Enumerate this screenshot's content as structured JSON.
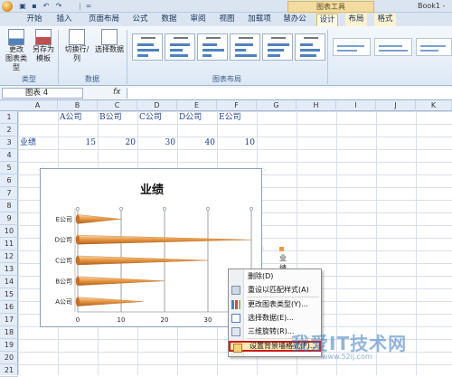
{
  "titlebar": {
    "chart_tools_label": "图表工具",
    "book_title": "Book1 -",
    "qat_separator": "|",
    "qat_arrow": "="
  },
  "tabs": [
    {
      "label": "开始"
    },
    {
      "label": "插入"
    },
    {
      "label": "页面布局"
    },
    {
      "label": "公式"
    },
    {
      "label": "数据"
    },
    {
      "label": "审阅"
    },
    {
      "label": "视图"
    },
    {
      "label": "加载项"
    },
    {
      "label": "慧办公"
    },
    {
      "label": "设计"
    },
    {
      "label": "布局"
    },
    {
      "label": "格式"
    }
  ],
  "ribbon": {
    "type_group": {
      "change_type": "更改\n图表类型",
      "save_template": "另存为\n模板",
      "label": "类型"
    },
    "data_group": {
      "switch_row_col": "切换行/列",
      "select_data": "选择数据",
      "label": "数据"
    },
    "layout_group": {
      "label": "图表布局"
    }
  },
  "formula_bar": {
    "name_box": "图表 4",
    "fx": "fx"
  },
  "grid": {
    "columns": [
      "A",
      "B",
      "C",
      "D",
      "E",
      "F",
      "G",
      "H",
      "I",
      "J",
      "K"
    ],
    "rows": [
      "1",
      "2",
      "3",
      "4",
      "5",
      "6",
      "7",
      "8",
      "9",
      "10",
      "11",
      "12",
      "13",
      "14",
      "15",
      "16",
      "17",
      "18",
      "19",
      "20",
      "21"
    ],
    "cells": {
      "b1": "A公司",
      "c1": "B公司",
      "d1": "C公司",
      "e1": "D公司",
      "f1": "E公司",
      "a2": "业绩",
      "b2": "15",
      "c2": "20",
      "d2": "30",
      "e2": "40",
      "f2": "10"
    }
  },
  "chart_data": {
    "type": "bar",
    "title": "业绩",
    "categories": [
      "A公司",
      "B公司",
      "C公司",
      "D公司",
      "E公司"
    ],
    "series": [
      {
        "name": "业绩",
        "values": [
          15,
          20,
          30,
          40,
          10
        ],
        "color": "#e99a44"
      }
    ],
    "xlim": [
      0,
      40
    ],
    "xticks": [
      0,
      10,
      20,
      30
    ],
    "legend": "right",
    "grid": true,
    "orientation": "horizontal",
    "mark_style": "cone"
  },
  "context_menu": {
    "items": [
      {
        "label": "删除(D)",
        "icon": "delete-icon"
      },
      {
        "label": "重设以匹配样式(A)",
        "icon": "reset-style-icon"
      },
      {
        "label": "更改图表类型(Y)...",
        "icon": "change-chart-type-icon"
      },
      {
        "label": "选择数据(E)...",
        "icon": "select-data-icon"
      },
      {
        "label": "三维旋转(R)...",
        "icon": "3d-rotation-icon"
      },
      {
        "label": "设置背景墙格式(F)...",
        "icon": "format-wall-icon"
      }
    ]
  },
  "watermark": {
    "text": "我爱IT技术网",
    "url": "www.52ij.com"
  },
  "colors": {
    "accent": "#4f81bd",
    "series": "#e99a44",
    "highlight_border": "#d21a1a"
  }
}
